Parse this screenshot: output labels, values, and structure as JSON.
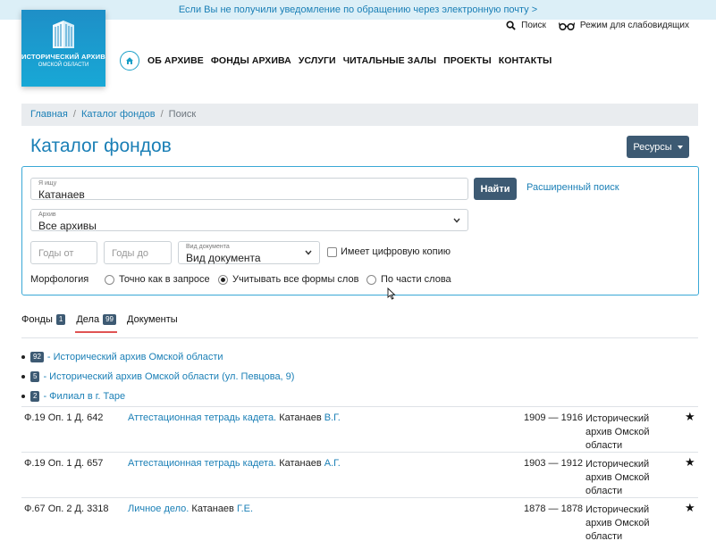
{
  "notice": "Если Вы не получили уведомление по обращению через электронную почту >",
  "logo": {
    "line1": "ИСТОРИЧЕСКИЙ АРХИВ",
    "line2": "ОМСКОЙ ОБЛАСТИ"
  },
  "top_tools": {
    "search": "Поиск",
    "low_vision": "Режим для слабовидящих"
  },
  "nav": [
    "ОБ АРХИВЕ",
    "ФОНДЫ АРХИВА",
    "УСЛУГИ",
    "ЧИТАЛЬНЫЕ ЗАЛЫ",
    "ПРОЕКТЫ",
    "КОНТАКТЫ"
  ],
  "breadcrumb": {
    "home": "Главная",
    "catalog": "Каталог фондов",
    "current": "Поиск",
    "separator": "/"
  },
  "page_title": "Каталог фондов",
  "resources_button": "Ресурсы",
  "search": {
    "query_label": "Я ищу",
    "query_value": "Катанаев",
    "find_button": "Найти",
    "advanced_link": "Расширенный поиск",
    "archive_label": "Архив",
    "archive_value": "Все архивы",
    "year_from_placeholder": "Годы от",
    "year_to_placeholder": "Годы до",
    "doc_type_label": "Вид документа",
    "doc_type_value": "Вид документа",
    "digital_copy_label": "Имеет цифровую копию",
    "morphology_label": "Морфология",
    "morph_options": [
      "Точно как в запросе",
      "Учитывать все формы слов",
      "По части слова"
    ],
    "morph_selected": "Учитывать все формы слов"
  },
  "tabs": [
    {
      "label": "Фонды",
      "count": "1"
    },
    {
      "label": "Дела",
      "count": "99"
    },
    {
      "label": "Документы",
      "count": ""
    }
  ],
  "active_tab": "Дела",
  "archives": [
    {
      "count": "92",
      "name": "- Исторический архив Омской области"
    },
    {
      "count": "5",
      "name": "- Исторический архив Омской области (ул. Певцова, 9)"
    },
    {
      "count": "2",
      "name": "- Филиал в г. Таре"
    }
  ],
  "results": [
    {
      "cipher": "Ф.19 Оп. 1 Д. 642",
      "title": "Аттестационная тетрадь кадета.",
      "surname": "Катанаев",
      "initials": "В.Г.",
      "dates": "1909 — 1916",
      "archive": "Исторический архив Омской области"
    },
    {
      "cipher": "Ф.19 Оп. 1 Д. 657",
      "title": "Аттестационная тетрадь кадета.",
      "surname": "Катанаев",
      "initials": "А.Г.",
      "dates": "1903 — 1912",
      "archive": "Исторический архив Омской области"
    },
    {
      "cipher": "Ф.67 Оп. 2 Д. 3318",
      "title": "Личное дело.",
      "surname": "Катанаев",
      "initials": "Г.Е.",
      "dates": "1878 — 1878",
      "archive": "Исторический архив Омской области"
    }
  ],
  "colors": {
    "accent": "#1a7fb6",
    "button": "#3d5a73",
    "notice_bg": "#dceff7",
    "tab_underline": "#e05353"
  },
  "icons": {
    "search": "search-icon",
    "low_vision": "glasses-icon",
    "home": "home-icon",
    "favorite": "star-icon"
  }
}
